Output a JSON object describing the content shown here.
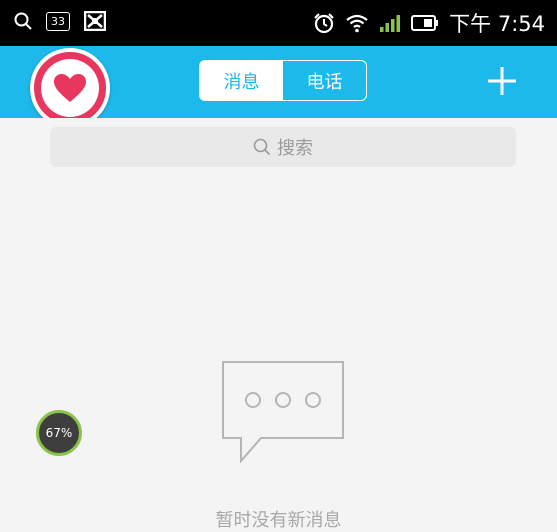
{
  "status_bar": {
    "left_icons": [
      "search-icon",
      "calendar-icon",
      "app-icon"
    ],
    "calendar_badge": "33",
    "right_icons": [
      "alarm-icon",
      "wifi-icon",
      "signal-icon",
      "battery-icon"
    ],
    "time": "下午 7:54"
  },
  "header": {
    "bg_color": "#1db9ea",
    "avatar_color": "#e8365f",
    "tabs": [
      {
        "label": "消息",
        "active": true
      },
      {
        "label": "电话",
        "active": false
      }
    ],
    "add_icon": "plus-icon"
  },
  "search": {
    "placeholder": "搜索",
    "icon": "search-icon"
  },
  "empty_state": {
    "icon": "speech-bubble-icon",
    "text": "暂时没有新消息"
  },
  "overlay": {
    "progress_text": "67%",
    "progress_value": 67
  }
}
